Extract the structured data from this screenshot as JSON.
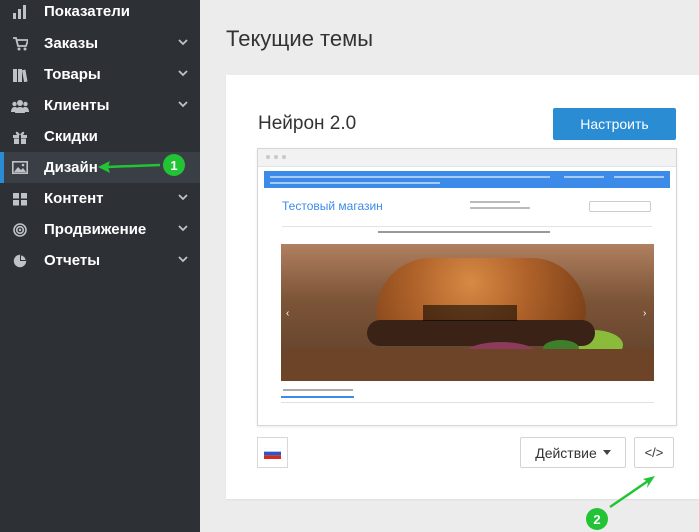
{
  "sidebar": {
    "items": [
      {
        "label": "Показатели",
        "icon": "bar-chart-icon",
        "has_chevron": false
      },
      {
        "label": "Заказы",
        "icon": "cart-icon",
        "has_chevron": true
      },
      {
        "label": "Товары",
        "icon": "books-icon",
        "has_chevron": true
      },
      {
        "label": "Клиенты",
        "icon": "users-icon",
        "has_chevron": true
      },
      {
        "label": "Скидки",
        "icon": "gift-icon",
        "has_chevron": false
      },
      {
        "label": "Дизайн",
        "icon": "image-icon",
        "has_chevron": false,
        "active": true
      },
      {
        "label": "Контент",
        "icon": "cube-icon",
        "has_chevron": true
      },
      {
        "label": "Продвижение",
        "icon": "target-icon",
        "has_chevron": true
      },
      {
        "label": "Отчеты",
        "icon": "pie-chart-icon",
        "has_chevron": true
      }
    ]
  },
  "main": {
    "title": "Текущие темы",
    "theme": {
      "name": "Нейрон 2.0",
      "configure_label": "Настроить",
      "action_label": "Действие",
      "code_label": "</>",
      "language_flag": "ru-flag"
    },
    "preview": {
      "store_title": "Тестовый магазин"
    }
  },
  "annotations": {
    "callout_1": "1",
    "callout_2": "2",
    "color": "#22c436"
  },
  "colors": {
    "sidebar_bg": "#2d3136",
    "accent": "#2a8dd4",
    "page_bg": "#ececec"
  }
}
